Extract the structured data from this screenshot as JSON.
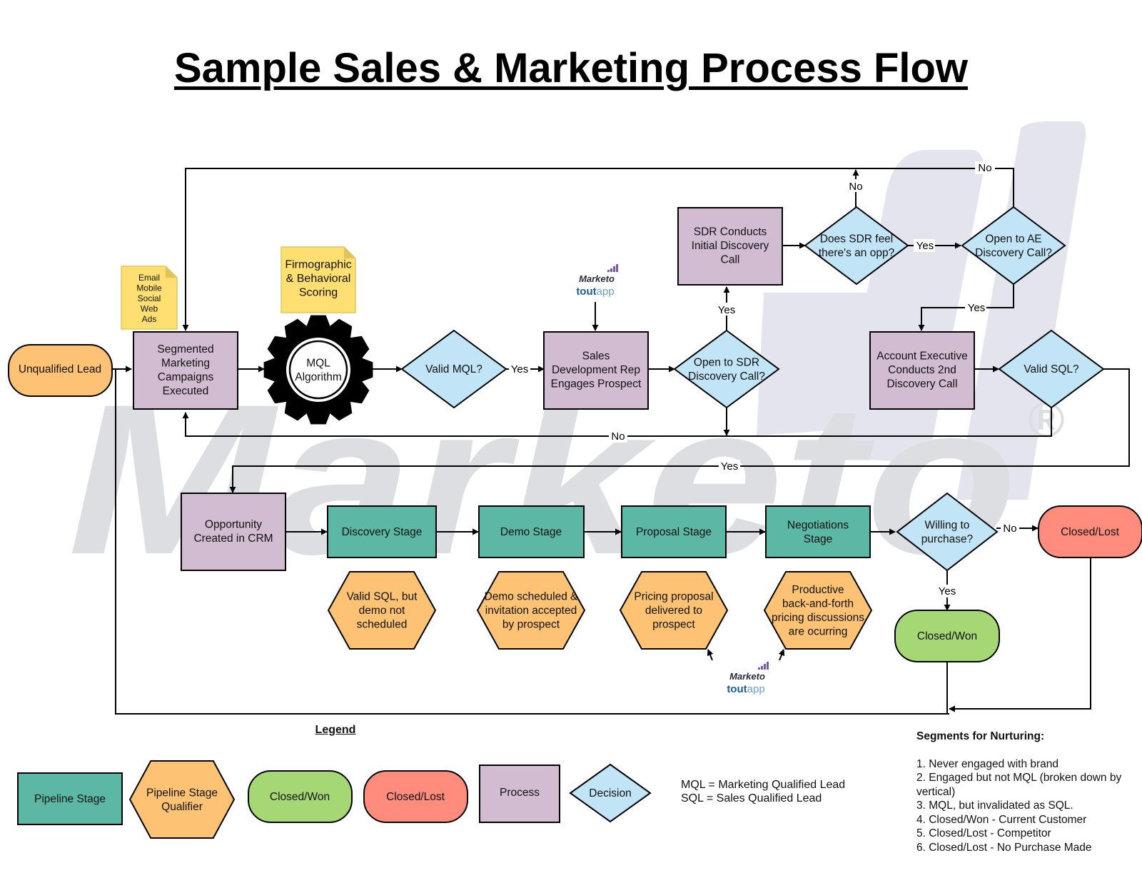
{
  "title": "Sample Sales & Marketing Process Flow",
  "watermark": {
    "text": "Marketo",
    "mark": "®",
    "color": "#dcdee2",
    "bars_color": "#e4e4ef"
  },
  "colors": {
    "pipeline_stage": "#5cb8a5",
    "qualifier": "#fdc274",
    "closed_won": "#a5d875",
    "closed_lost": "#ff8c7d",
    "process": "#d1bcd2",
    "decision": "#c1e4f6",
    "note": "#ffdf71",
    "start": "#fdc274",
    "line": "#000000"
  },
  "nodes": {
    "unqualified_lead": "Unqualified Lead",
    "note_channels": [
      "Email",
      "Mobile",
      "Social",
      "Web",
      "Ads"
    ],
    "note_scoring": [
      "Firmographic",
      "& Behavioral",
      "Scoring"
    ],
    "segmented_campaigns": [
      "Segmented",
      "Marketing",
      "Campaigns",
      "Executed"
    ],
    "mql_algorithm": [
      "MQL",
      "Algorithm"
    ],
    "valid_mql": [
      "Valid MQL?"
    ],
    "sdr_engages": [
      "Sales",
      "Development Rep",
      "Engages Prospect"
    ],
    "open_sdr_call": [
      "Open to SDR",
      "Discovery Call?"
    ],
    "sdr_initial_call": [
      "SDR Conducts",
      "Initial Discovery",
      "Call"
    ],
    "sdr_feel_opp": [
      "Does SDR feel",
      "there's an opp?"
    ],
    "open_ae_call": [
      "Open to AE",
      "Discovery Call?"
    ],
    "ae_second_call": [
      "Account Executive",
      "Conducts 2nd",
      "Discovery Call"
    ],
    "valid_sql": [
      "Valid SQL?"
    ],
    "opportunity_crm": [
      "Opportunity",
      "Created in CRM"
    ],
    "discovery_stage": [
      "Discovery Stage"
    ],
    "demo_stage": [
      "Demo Stage"
    ],
    "proposal_stage": [
      "Proposal Stage"
    ],
    "negotiations_stage": [
      "Negotiations",
      "Stage"
    ],
    "willing_purchase": [
      "Willing to",
      "purchase?"
    ],
    "closed_lost": [
      "Closed/Lost"
    ],
    "closed_won": [
      "Closed/Won"
    ],
    "q_discovery": [
      "Valid SQL, but",
      "demo not",
      "scheduled"
    ],
    "q_demo": [
      "Demo scheduled &",
      "invitation accepted",
      "by prospect"
    ],
    "q_proposal": [
      "Pricing proposal",
      "delivered to",
      "prospect"
    ],
    "q_negotiation": [
      "Productive",
      "back-and-forth",
      "pricing discussions",
      "are ocurring"
    ]
  },
  "edge_labels": {
    "yes": "Yes",
    "no": "No"
  },
  "logo": {
    "brand": "Marketo",
    "product_bold": "tout",
    "product_light": "app"
  },
  "legend": {
    "title": "Legend",
    "items": [
      {
        "label": [
          "Pipeline Stage"
        ],
        "shape": "rect"
      },
      {
        "label": [
          "Pipeline Stage",
          "Qualifier"
        ],
        "shape": "hexagon"
      },
      {
        "label": [
          "Closed/Won"
        ],
        "shape": "rounded"
      },
      {
        "label": [
          "Closed/Lost"
        ],
        "shape": "rounded"
      },
      {
        "label": [
          "Process"
        ],
        "shape": "rect"
      },
      {
        "label": [
          "Decision"
        ],
        "shape": "diamond"
      }
    ]
  },
  "abbreviations": [
    "MQL = Marketing Qualified Lead",
    "SQL = Sales Qualified Lead"
  ],
  "segments": {
    "title": "Segments for Nurturing:",
    "items": [
      "1. Never engaged with brand",
      "2. Engaged but not MQL (broken down by vertical)",
      "3. MQL, but invalidated as SQL.",
      "4. Closed/Won - Current Customer",
      "5. Closed/Lost  - Competitor",
      "6. Closed/Lost - No Purchase Made"
    ]
  }
}
